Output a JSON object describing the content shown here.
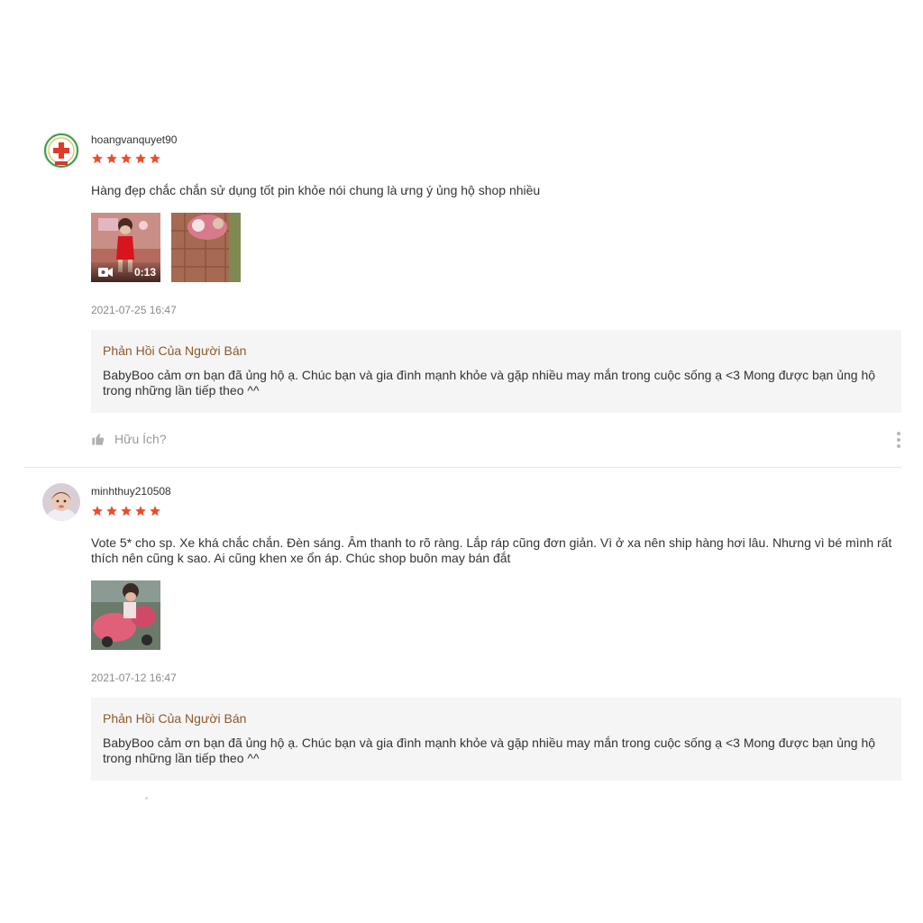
{
  "reviews": [
    {
      "username": "hoangvanquyet90",
      "rating": 5,
      "comment": "Hàng đẹp chắc chắn sử dụng tốt pin khỏe nói chung là ưng ý ủng hộ shop nhiều",
      "media": [
        {
          "type": "video",
          "duration": "0:13"
        },
        {
          "type": "image"
        }
      ],
      "timestamp": "2021-07-25 16:47",
      "reply": {
        "title": "Phản Hồi Của Người Bán",
        "text": "BabyBoo cảm ơn bạn đã ủng hộ ạ. Chúc bạn và gia đình mạnh khỏe và gặp nhiều may mắn trong cuộc sống ạ <3 Mong được bạn ủng hộ trong những lần tiếp theo ^^"
      },
      "helpful_label": "Hữu Ích?"
    },
    {
      "username": "minhthuy210508",
      "rating": 5,
      "comment": "Vote 5* cho sp. Xe khá chắc chắn. Đèn sáng. Âm thanh to rõ ràng. Lắp ráp cũng đơn giản. Vì ở xa nên ship hàng hơi lâu. Nhưng vì bé mình rất thích nên cũng k sao. Ai cũng khen xe ổn áp. Chúc shop buôn may bán đắt",
      "media": [
        {
          "type": "image"
        }
      ],
      "timestamp": "2021-07-12 16:47",
      "reply": {
        "title": "Phản Hồi Của Người Bán",
        "text": "BabyBoo cảm ơn bạn đã ủng hộ ạ. Chúc bạn và gia đình mạnh khỏe và gặp nhiều may mắn trong cuộc sống ạ <3 Mong được bạn ủng hộ trong những lần tiếp theo ^^"
      }
    }
  ],
  "colors": {
    "star": "#ee4d2d",
    "reply_title": "#8b5a2b",
    "reply_bg": "#f5f5f5",
    "timestamp": "#8a8a8a"
  },
  "icons": {
    "star": "star-icon",
    "helpful": "thumbs-up-icon",
    "more": "more-vertical-icon",
    "video": "video-camera-icon"
  }
}
